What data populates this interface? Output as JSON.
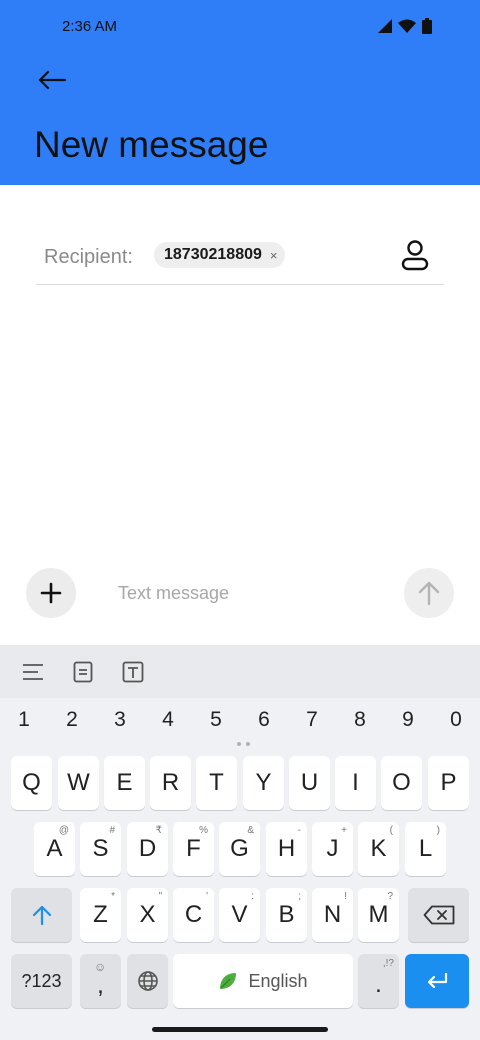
{
  "status_bar": {
    "time": "2:36 AM"
  },
  "header": {
    "title": "New message",
    "accent_color": "#2f7ef7"
  },
  "recipient": {
    "label": "Recipient:",
    "chips": [
      {
        "number": "18730218809",
        "remove_symbol": "×"
      }
    ]
  },
  "compose": {
    "placeholder": "Text message"
  },
  "keyboard": {
    "number_row": [
      "1",
      "2",
      "3",
      "4",
      "5",
      "6",
      "7",
      "8",
      "9",
      "0"
    ],
    "row1": [
      {
        "key": "Q"
      },
      {
        "key": "W"
      },
      {
        "key": "E"
      },
      {
        "key": "R"
      },
      {
        "key": "T"
      },
      {
        "key": "Y"
      },
      {
        "key": "U"
      },
      {
        "key": "I"
      },
      {
        "key": "O"
      },
      {
        "key": "P"
      }
    ],
    "row2": [
      {
        "key": "A",
        "hint": "@"
      },
      {
        "key": "S",
        "hint": "#"
      },
      {
        "key": "D",
        "hint": "₹"
      },
      {
        "key": "F",
        "hint": "%"
      },
      {
        "key": "G",
        "hint": "&"
      },
      {
        "key": "H",
        "hint": "-"
      },
      {
        "key": "J",
        "hint": "+"
      },
      {
        "key": "K",
        "hint": "("
      },
      {
        "key": "L",
        "hint": ")"
      }
    ],
    "row3": [
      {
        "key": "Z",
        "hint": "*"
      },
      {
        "key": "X",
        "hint": "\""
      },
      {
        "key": "C",
        "hint": "'"
      },
      {
        "key": "V",
        "hint": ":"
      },
      {
        "key": "B",
        "hint": ";"
      },
      {
        "key": "N",
        "hint": "!"
      },
      {
        "key": "M",
        "hint": "?"
      }
    ],
    "symbols_key": "?123",
    "comma_key": ",",
    "space_label": "English",
    "period_key": ".",
    "period_hint": ",!?"
  }
}
